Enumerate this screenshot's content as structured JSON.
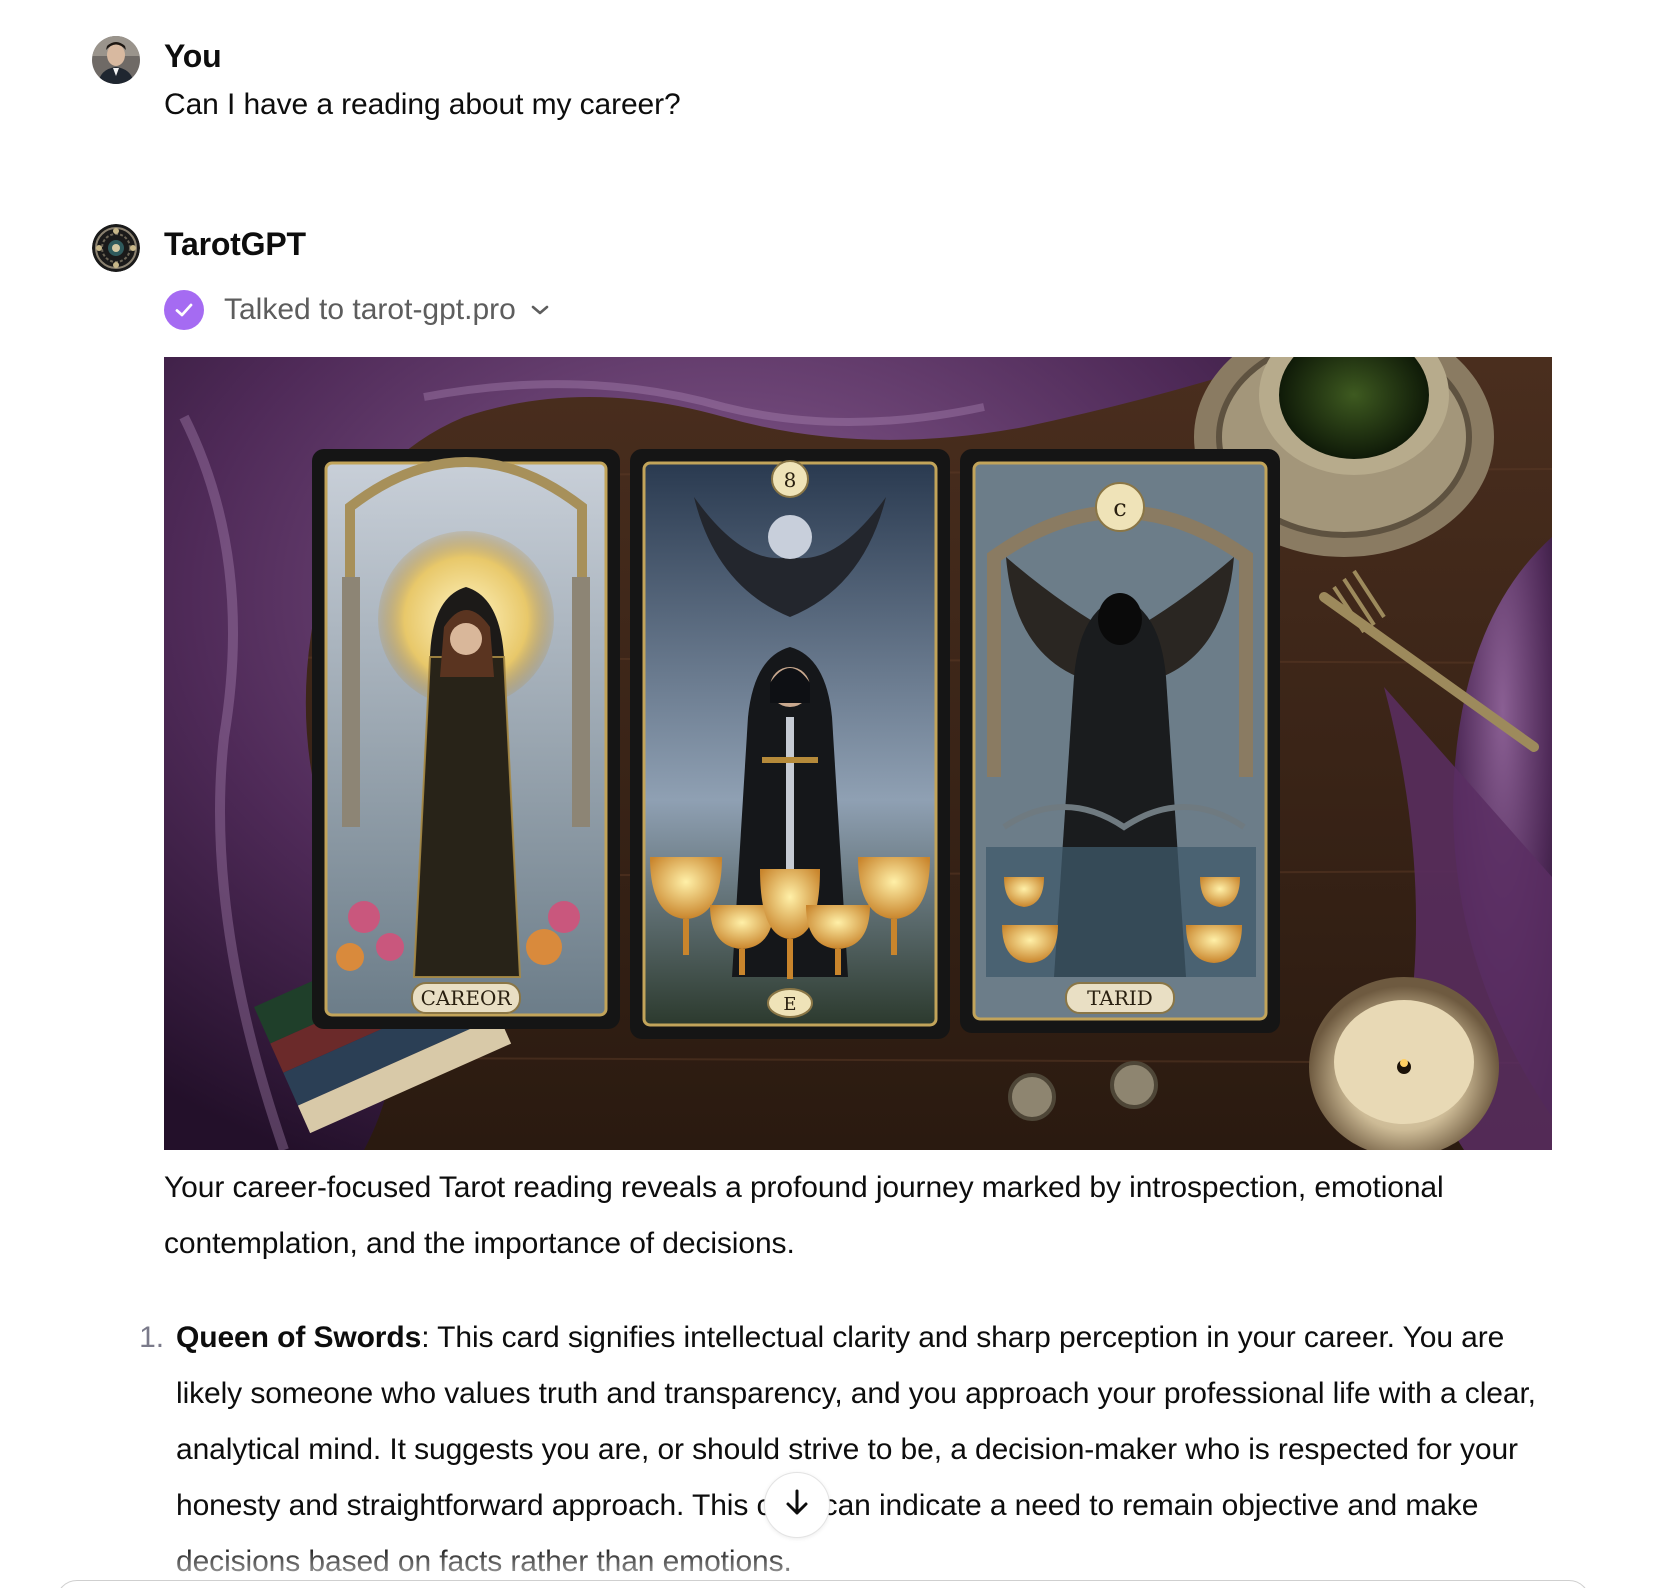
{
  "conversation": {
    "user_message": {
      "author": "You",
      "text": "Can I have a reading about my career?"
    },
    "assistant_message": {
      "author": "TarotGPT",
      "plugin_status": "Talked to tarot-gpt.pro",
      "image": {
        "cards": [
          {
            "number": "",
            "caption": "CAREOR"
          },
          {
            "number": "8",
            "caption": "E"
          },
          {
            "number": "ⅽ",
            "caption": "TARID"
          }
        ]
      },
      "intro_text": "Your career-focused Tarot reading reveals a profound journey marked by introspection, emotional contemplation, and the importance of decisions.",
      "list": [
        {
          "number": "1.",
          "title": "Queen of Swords",
          "text": ": This card signifies intellectual clarity and sharp perception in your career. You are likely someone who values truth and transparency, and you approach your professional life with a clear, analytical mind. It suggests you are, or should strive to be, a decision-maker who is respected for your honesty and straightforward approach. This card can indicate a need to remain objective and make decisions based on facts rather than emotions."
        }
      ]
    }
  },
  "colors": {
    "check_badge": "#a56bf2",
    "text": "#0d0d0d",
    "muted_text": "#5d5d5d"
  },
  "icons": {
    "status": "check-icon",
    "expand": "chevron-down-icon",
    "scroll": "arrow-down-icon"
  }
}
